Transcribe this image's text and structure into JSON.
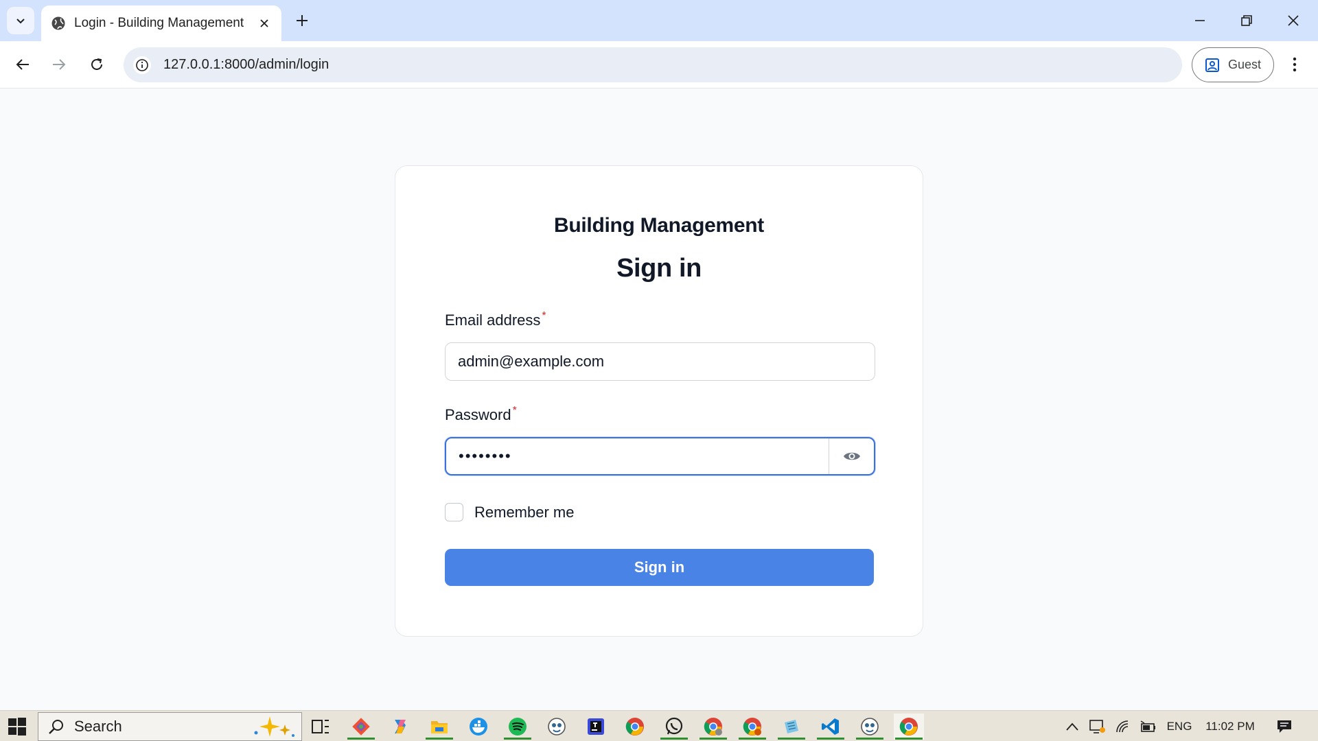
{
  "browser": {
    "tab_title": "Login - Building Management",
    "url": "127.0.0.1:8000/admin/login",
    "profile_label": "Guest"
  },
  "login": {
    "brand": "Building Management",
    "heading": "Sign in",
    "email_label": "Email address",
    "email_value": "admin@example.com",
    "password_label": "Password",
    "password_value": "••••••••",
    "required_mark": "*",
    "remember_label": "Remember me",
    "submit_label": "Sign in"
  },
  "taskbar": {
    "search_label": "Search",
    "language": "ENG",
    "time": "11:02 PM",
    "apps": [
      "git-icon",
      "copilot-icon",
      "file-explorer-icon",
      "docker-icon",
      "spotify-icon",
      "pgadmin-icon",
      "jetbrains-icon",
      "chrome-icon",
      "whatsapp-icon",
      "chrome-profile-icon",
      "chrome-profile-icon",
      "notepad-icon",
      "vscode-icon",
      "pgadmin-icon",
      "chrome-icon"
    ]
  },
  "colors": {
    "accent": "#4a83e6",
    "required": "#dc2626",
    "focus_border": "#3b72d9",
    "tabbar": "#d3e3fd"
  }
}
